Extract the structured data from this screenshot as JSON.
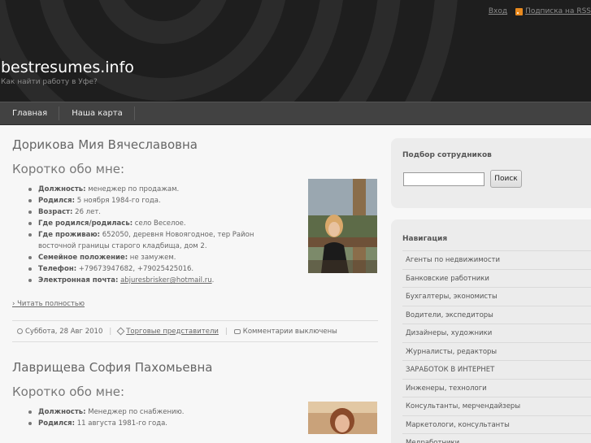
{
  "header": {
    "site_title": "bestresumes.info",
    "tagline": "Как найти работу в Уфе?",
    "login": "Вход",
    "rss": "Подписка на RSS"
  },
  "nav": {
    "items": [
      {
        "label": "Главная"
      },
      {
        "label": "Наша карта"
      }
    ]
  },
  "posts": [
    {
      "title": "Дорикова Мия Вячеславовна",
      "section": "Коротко обо мне:",
      "fields": [
        {
          "label": "Должность:",
          "value": " менеджер по продажам."
        },
        {
          "label": "Родился:",
          "value": " 5 ноября 1984-го года."
        },
        {
          "label": "Возраст:",
          "value": " 26 лет."
        },
        {
          "label": "Где родился/родилась:",
          "value": " село Веселое."
        },
        {
          "label": "Где проживаю:",
          "value": " 652050, деревня Новоягодное, тер Район восточной границы старого кладбища, дом 2."
        },
        {
          "label": "Семейное положение:",
          "value": " не замужем."
        },
        {
          "label": "Телефон:",
          "value": " +79673947682, +79025425016."
        },
        {
          "label": "Электронная почта:",
          "value": " ",
          "link": "abjuresbrisker@hotmail.ru",
          "after": "."
        }
      ],
      "readmore": "› Читать полностью",
      "meta": {
        "date": "Суббота, 28 Авг 2010",
        "category": "Торговые представители",
        "comments": "Комментарии выключены"
      }
    },
    {
      "title": "Лаврищева София Пахомьевна",
      "section": "Коротко обо мне:",
      "fields": [
        {
          "label": "Должность:",
          "value": " Менеджер по снабжению."
        },
        {
          "label": "Родился:",
          "value": " 11 августа 1981-го года."
        }
      ]
    }
  ],
  "sidebar": {
    "search": {
      "title": "Подбор сотрудников",
      "placeholder": "",
      "button": "Поиск"
    },
    "navigation": {
      "title": "Навигация",
      "items": [
        "Агенты по недвижимости",
        "Банковские работники",
        "Бухгалтеры, экономисты",
        "Водители, экспедиторы",
        "Дизайнеры, художники",
        "Журналисты, редакторы",
        "ЗАРАБОТОК В ИНТЕРНЕТ",
        "Инженеры, технологи",
        "Консультанты, мерчендайзеры",
        "Маркетологи, консультанты",
        "Медработники"
      ]
    }
  },
  "colors": {
    "header_bg": "#1e1e1e",
    "nav_bg": "#424242",
    "page_bg": "#f7f7f7",
    "sidebar_box": "#ececec",
    "rss_orange": "#e98a1e"
  }
}
